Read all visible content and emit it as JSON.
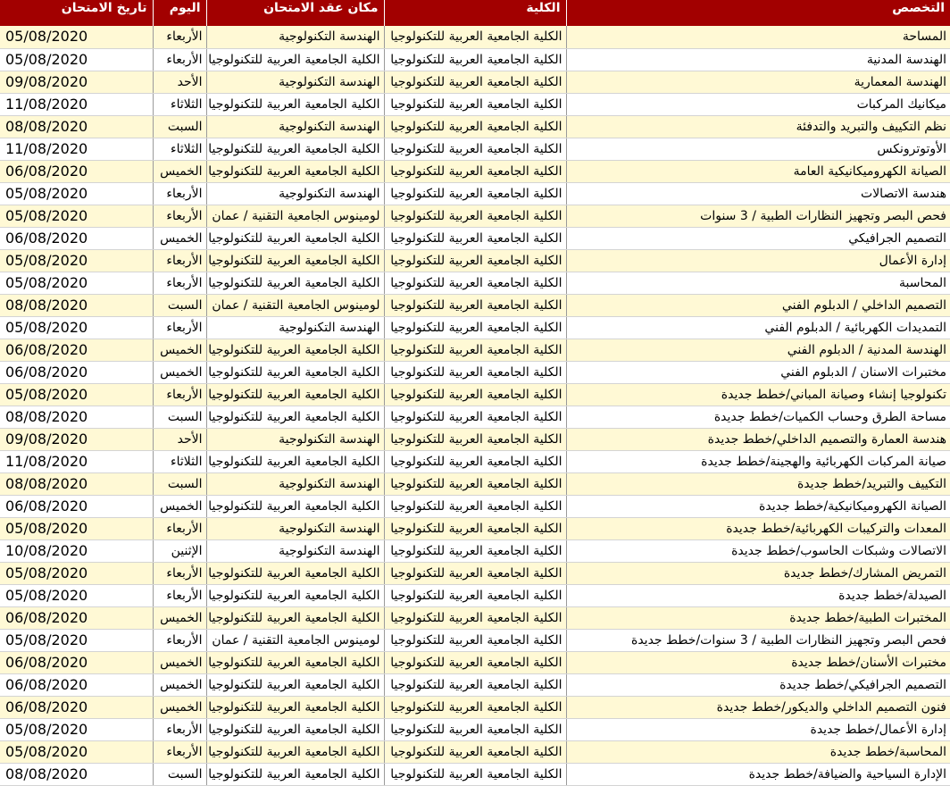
{
  "columns": [
    "التخصص",
    "الكلية",
    "مكان عقد الامتحان",
    "اليوم",
    "تاريخ الامتحان"
  ],
  "rows": [
    [
      "المساحة",
      "الكلية الجامعية العربية للتكنولوجيا",
      "الهندسة التكنولوجية",
      "الأربعاء",
      "05/08/2020"
    ],
    [
      "الهندسة المدنية",
      "الكلية الجامعية العربية للتكنولوجيا",
      "الكلية الجامعية العربية للتكنولوجيا",
      "الأربعاء",
      "05/08/2020"
    ],
    [
      "الهندسة المعمارية",
      "الكلية الجامعية العربية للتكنولوجيا",
      "الهندسة التكنولوجية",
      "الأحد",
      "09/08/2020"
    ],
    [
      "ميكانيك المركبات",
      "الكلية الجامعية العربية للتكنولوجيا",
      "الكلية الجامعية العربية للتكنولوجيا",
      "الثلاثاء",
      "11/08/2020"
    ],
    [
      "نظم التكييف والتبريد والتدفئة",
      "الكلية الجامعية العربية للتكنولوجيا",
      "الهندسة التكنولوجية",
      "السبت",
      "08/08/2020"
    ],
    [
      "الأوتوترونكس",
      "الكلية الجامعية العربية للتكنولوجيا",
      "الكلية الجامعية العربية للتكنولوجيا",
      "الثلاثاء",
      "11/08/2020"
    ],
    [
      "الصيانة الكهروميكانيكية العامة",
      "الكلية الجامعية العربية للتكنولوجيا",
      "الكلية الجامعية العربية للتكنولوجيا",
      "الخميس",
      "06/08/2020"
    ],
    [
      "هندسة الاتصالات",
      "الكلية الجامعية العربية للتكنولوجيا",
      "الهندسة التكنولوجية",
      "الأربعاء",
      "05/08/2020"
    ],
    [
      "فحص البصر وتجهيز النظارات الطبية / 3 سنوات",
      "الكلية الجامعية العربية للتكنولوجيا",
      "لومينوس الجامعية التقنية / عمان",
      "الأربعاء",
      "05/08/2020"
    ],
    [
      "التصميم الجرافيكي",
      "الكلية الجامعية العربية للتكنولوجيا",
      "الكلية الجامعية العربية للتكنولوجيا",
      "الخميس",
      "06/08/2020"
    ],
    [
      "إدارة الأعمال",
      "الكلية الجامعية العربية للتكنولوجيا",
      "الكلية الجامعية العربية للتكنولوجيا",
      "الأربعاء",
      "05/08/2020"
    ],
    [
      "المحاسبة",
      "الكلية الجامعية العربية للتكنولوجيا",
      "الكلية الجامعية العربية للتكنولوجيا",
      "الأربعاء",
      "05/08/2020"
    ],
    [
      "التصميم الداخلي / الدبلوم الفني",
      "الكلية الجامعية العربية للتكنولوجيا",
      "لومينوس الجامعية التقنية / عمان",
      "السبت",
      "08/08/2020"
    ],
    [
      "التمديدات الكهربائية / الدبلوم الفني",
      "الكلية الجامعية العربية للتكنولوجيا",
      "الهندسة التكنولوجية",
      "الأربعاء",
      "05/08/2020"
    ],
    [
      "الهندسة المدنية / الدبلوم الفني",
      "الكلية الجامعية العربية للتكنولوجيا",
      "الكلية الجامعية العربية للتكنولوجيا",
      "الخميس",
      "06/08/2020"
    ],
    [
      "مختبرات الاسنان / الدبلوم الفني",
      "الكلية الجامعية العربية للتكنولوجيا",
      "الكلية الجامعية العربية للتكنولوجيا",
      "الخميس",
      "06/08/2020"
    ],
    [
      "تكنولوجيا إنشاء وصيانة المباني/خطط جديدة",
      "الكلية الجامعية العربية للتكنولوجيا",
      "الكلية الجامعية العربية للتكنولوجيا",
      "الأربعاء",
      "05/08/2020"
    ],
    [
      "مساحة الطرق وحساب الكميات/خطط جديدة",
      "الكلية الجامعية العربية للتكنولوجيا",
      "الكلية الجامعية العربية للتكنولوجيا",
      "السبت",
      "08/08/2020"
    ],
    [
      "هندسة العمارة والتصميم الداخلي/خطط جديدة",
      "الكلية الجامعية العربية للتكنولوجيا",
      "الهندسة التكنولوجية",
      "الأحد",
      "09/08/2020"
    ],
    [
      "صيانة المركبات الكهربائية والهجينة/خطط جديدة",
      "الكلية الجامعية العربية للتكنولوجيا",
      "الكلية الجامعية العربية للتكنولوجيا",
      "الثلاثاء",
      "11/08/2020"
    ],
    [
      "التكييف والتبريد/خطط جديدة",
      "الكلية الجامعية العربية للتكنولوجيا",
      "الهندسة التكنولوجية",
      "السبت",
      "08/08/2020"
    ],
    [
      "الصيانة الكهروميكانيكية/خطط جديدة",
      "الكلية الجامعية العربية للتكنولوجيا",
      "الكلية الجامعية العربية للتكنولوجيا",
      "الخميس",
      "06/08/2020"
    ],
    [
      "المعدات والتركيبات الكهربائية/خطط جديدة",
      "الكلية الجامعية العربية للتكنولوجيا",
      "الهندسة التكنولوجية",
      "الأربعاء",
      "05/08/2020"
    ],
    [
      "الاتصالات وشبكات الحاسوب/خطط جديدة",
      "الكلية الجامعية العربية للتكنولوجيا",
      "الهندسة التكنولوجية",
      "الإثنين",
      "10/08/2020"
    ],
    [
      "التمريض المشارك/خطط جديدة",
      "الكلية الجامعية العربية للتكنولوجيا",
      "الكلية الجامعية العربية للتكنولوجيا",
      "الأربعاء",
      "05/08/2020"
    ],
    [
      "الصيدلة/خطط جديدة",
      "الكلية الجامعية العربية للتكنولوجيا",
      "الكلية الجامعية العربية للتكنولوجيا",
      "الأربعاء",
      "05/08/2020"
    ],
    [
      "المختبرات الطبية/خطط جديدة",
      "الكلية الجامعية العربية للتكنولوجيا",
      "الكلية الجامعية العربية للتكنولوجيا",
      "الخميس",
      "06/08/2020"
    ],
    [
      "فحص البصر وتجهيز النظارات الطبية / 3 سنوات/خطط جديدة",
      "الكلية الجامعية العربية للتكنولوجيا",
      "لومينوس الجامعية التقنية / عمان",
      "الأربعاء",
      "05/08/2020"
    ],
    [
      "مختبرات الأسنان/خطط جديدة",
      "الكلية الجامعية العربية للتكنولوجيا",
      "الكلية الجامعية العربية للتكنولوجيا",
      "الخميس",
      "06/08/2020"
    ],
    [
      "التصميم الجرافيكي/خطط جديدة",
      "الكلية الجامعية العربية للتكنولوجيا",
      "الكلية الجامعية العربية للتكنولوجيا",
      "الخميس",
      "06/08/2020"
    ],
    [
      "فنون التصميم الداخلي والديكور/خطط جديدة",
      "الكلية الجامعية العربية للتكنولوجيا",
      "الكلية الجامعية العربية للتكنولوجيا",
      "الخميس",
      "06/08/2020"
    ],
    [
      "إدارة الأعمال/خطط جديدة",
      "الكلية الجامعية العربية للتكنولوجيا",
      "الكلية الجامعية العربية للتكنولوجيا",
      "الأربعاء",
      "05/08/2020"
    ],
    [
      "المحاسبة/خطط جديدة",
      "الكلية الجامعية العربية للتكنولوجيا",
      "الكلية الجامعية العربية للتكنولوجيا",
      "الأربعاء",
      "05/08/2020"
    ],
    [
      "الإدارة السياحية والضيافة/خطط جديدة",
      "الكلية الجامعية العربية للتكنولوجيا",
      "الكلية الجامعية العربية للتكنولوجيا",
      "السبت",
      "08/08/2020"
    ]
  ],
  "colors": {
    "header_bg": "#a20000",
    "header_text": "#ffffff",
    "row_odd_bg": "#fff9d5",
    "row_even_bg": "#ffffff"
  }
}
